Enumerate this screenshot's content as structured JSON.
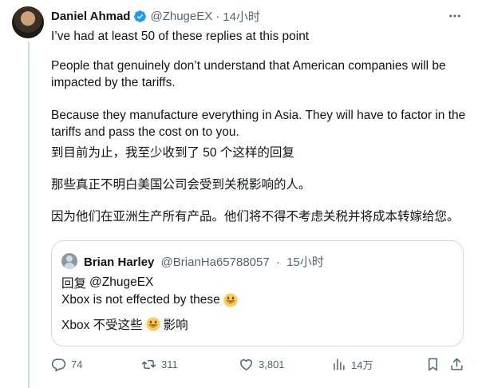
{
  "tweet": {
    "author_name": "Daniel Ahmad",
    "handle": "@ZhugeEX",
    "separator": "·",
    "time": "14小时",
    "lines": [
      "I’ve had at least 50 of these replies at this point",
      "People that genuinely don’t understand that American companies will be impacted by the tariffs.",
      "Because they manufacture everything in Asia. They will have to factor in the tariffs and pass the cost on to you.",
      "到目前为止，我至少收到了 50 个这样的回复",
      "那些真正不明白美国公司会受到关税影响的人。",
      "因为他们在亚洲生产所有产品。他们将不得不考虑关税并将成本转嫁给您。"
    ]
  },
  "quote": {
    "author_name": "Brian Harley",
    "handle": "@BrianHa65788057",
    "separator": "·",
    "time": "15小时",
    "reply_prefix": "回复",
    "reply_to": "@ZhugeEX",
    "line1": "Xbox is not effected by these",
    "line2_before": "Xbox 不受这些",
    "line2_after": "影响"
  },
  "actions": {
    "replies": "74",
    "retweets": "311",
    "likes": "3,801",
    "views": "14万"
  },
  "icons": {
    "verified": "verified-badge-icon",
    "more": "more-dots-icon",
    "reply": "reply-icon",
    "retweet": "retweet-icon",
    "like": "heart-icon",
    "views": "views-chart-icon",
    "bookmark": "bookmark-icon",
    "share": "share-icon",
    "emoji": "grinning-face-emoji"
  },
  "colors": {
    "text": "#0f1419",
    "muted": "#536471",
    "verified": "#1d9bf0",
    "border": "#cfd9de"
  }
}
